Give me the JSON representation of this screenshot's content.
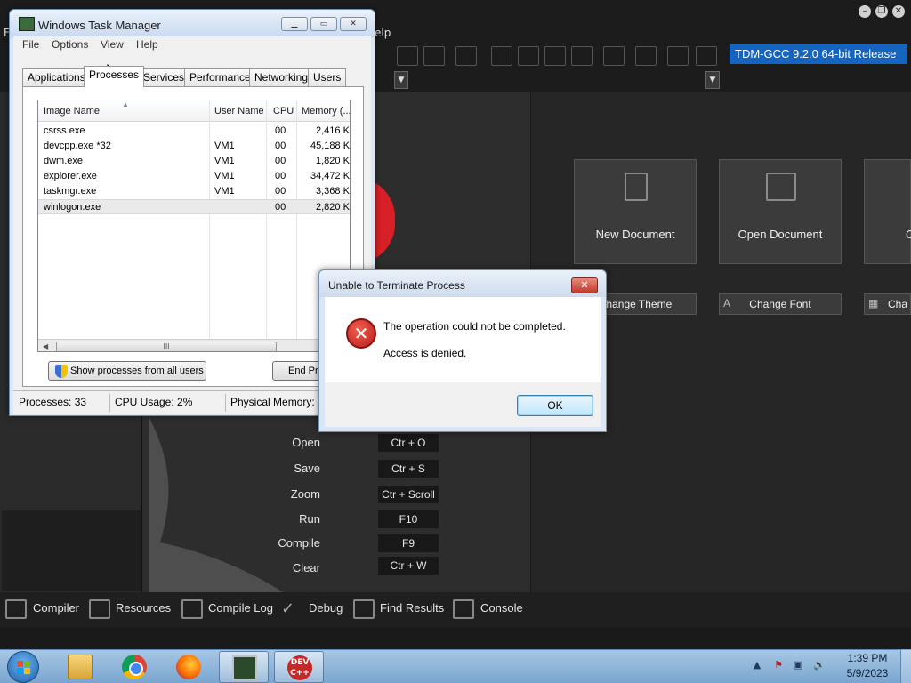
{
  "devcpp": {
    "menu_help": "elp",
    "menu_f": "F",
    "compiler_select": "TDM-GCC 9.2.0 64-bit Release",
    "tiles": [
      {
        "label": "New Document"
      },
      {
        "label": "Open Document"
      },
      {
        "label": "C"
      }
    ],
    "small_tiles": [
      {
        "label": "Change Theme"
      },
      {
        "label": "Change Font"
      },
      {
        "label": "Cha"
      }
    ],
    "shortcuts": [
      {
        "action": "Open",
        "key": "Ctr + O"
      },
      {
        "action": "Save",
        "key": "Ctr + S"
      },
      {
        "action": "Zoom",
        "key": "Ctr + Scroll"
      },
      {
        "action": "Run",
        "key": "F10"
      },
      {
        "action": "Compile",
        "key": "F9"
      },
      {
        "action": "Clear",
        "key": "Ctr + W"
      }
    ],
    "bottom_tabs": [
      "Compiler",
      "Resources",
      "Compile Log",
      "Debug",
      "Find Results",
      "Console"
    ]
  },
  "taskmgr": {
    "title": "Windows Task Manager",
    "menu": [
      "File",
      "Options",
      "View",
      "Help"
    ],
    "tabs": [
      "Applications",
      "Processes",
      "Services",
      "Performance",
      "Networking",
      "Users"
    ],
    "active_tab": "Processes",
    "columns": [
      "Image Name",
      "User Name",
      "CPU",
      "Memory (..."
    ],
    "rows": [
      {
        "name": "csrss.exe",
        "user": "",
        "cpu": "00",
        "mem": "2,416 K"
      },
      {
        "name": "devcpp.exe *32",
        "user": "VM1",
        "cpu": "00",
        "mem": "45,188 K"
      },
      {
        "name": "dwm.exe",
        "user": "VM1",
        "cpu": "00",
        "mem": "1,820 K"
      },
      {
        "name": "explorer.exe",
        "user": "VM1",
        "cpu": "00",
        "mem": "34,472 K"
      },
      {
        "name": "taskmgr.exe",
        "user": "VM1",
        "cpu": "00",
        "mem": "3,368 K"
      },
      {
        "name": "winlogon.exe",
        "user": "",
        "cpu": "00",
        "mem": "2,820 K"
      }
    ],
    "scroll_thumb": "III",
    "show_all_button": "Show processes from all users",
    "end_process_button": "End Process",
    "status": {
      "processes": "Processes: 33",
      "cpu": "CPU Usage: 2%",
      "memory": "Physical Memory: 2"
    }
  },
  "error_dialog": {
    "title": "Unable to Terminate Process",
    "close_glyph": "✕",
    "message1": "The operation could not be completed.",
    "message2": "Access is denied.",
    "ok_label": "OK",
    "icon_glyph": "✕"
  },
  "taskbar": {
    "time": "1:39 PM",
    "date": "5/9/2023",
    "devcpp_icon_text": "DEV C++"
  },
  "colors": {
    "accent_blue": "#1565c0",
    "error_red": "#c62828",
    "devcpp_bg": "#262626"
  }
}
